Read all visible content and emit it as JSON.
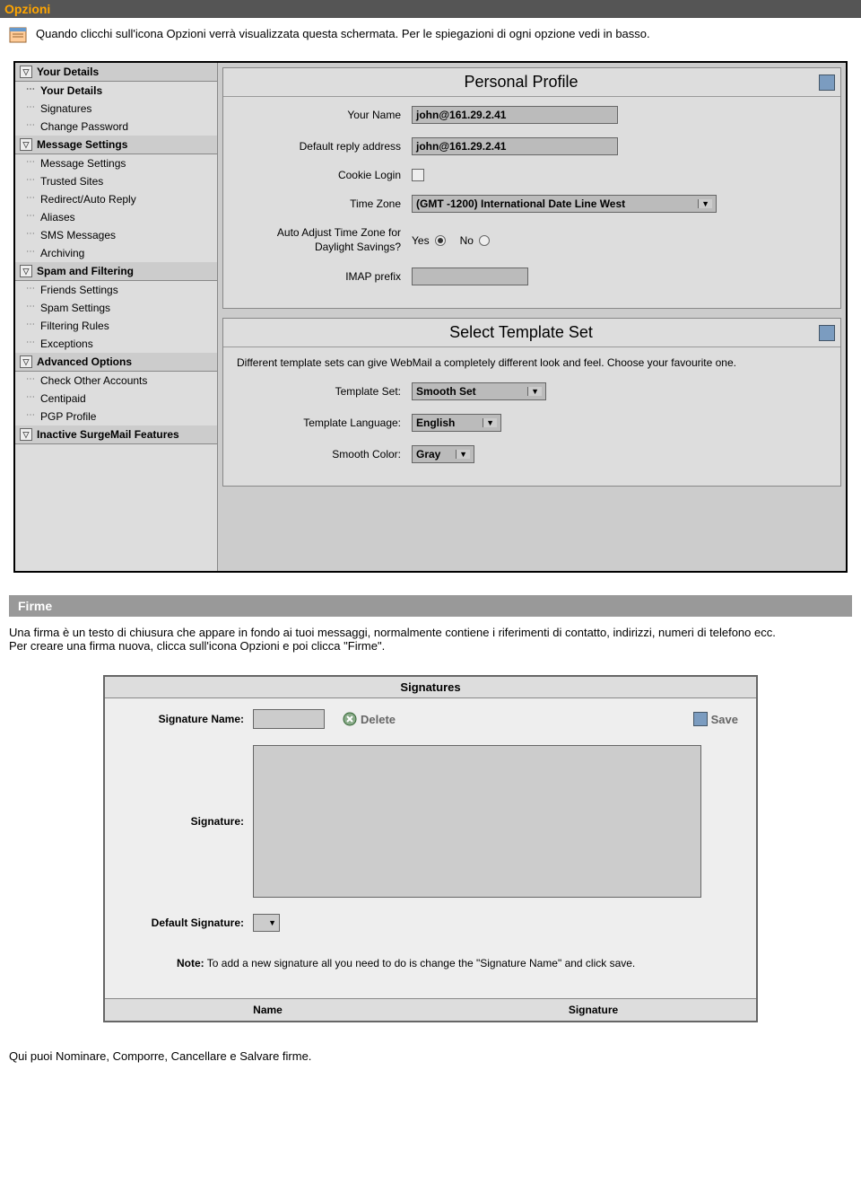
{
  "section1": {
    "title": "Opzioni",
    "intro": "Quando clicchi sull'icona Opzioni verrà visualizzata questa schermata. Per le spiegazioni di ogni opzione vedi in basso."
  },
  "sidebar": {
    "sections": [
      {
        "title": "Your Details",
        "items": [
          "Your Details",
          "Signatures",
          "Change Password"
        ]
      },
      {
        "title": "Message Settings",
        "items": [
          "Message Settings",
          "Trusted Sites",
          "Redirect/Auto Reply",
          "Aliases",
          "SMS Messages",
          "Archiving"
        ]
      },
      {
        "title": "Spam and Filtering",
        "items": [
          "Friends Settings",
          "Spam Settings",
          "Filtering Rules",
          "Exceptions"
        ]
      },
      {
        "title": "Advanced Options",
        "items": [
          "Check Other Accounts",
          "Centipaid",
          "PGP Profile"
        ]
      },
      {
        "title": "Inactive SurgeMail Features",
        "items": []
      }
    ]
  },
  "profile": {
    "title": "Personal Profile",
    "labels": {
      "name": "Your Name",
      "reply": "Default reply address",
      "cookie": "Cookie Login",
      "tz": "Time Zone",
      "dst": "Auto Adjust Time Zone for Daylight Savings?",
      "imap": "IMAP prefix"
    },
    "values": {
      "name": "john@161.29.2.41",
      "reply": "john@161.29.2.41",
      "tz": "(GMT -1200) International Date Line West"
    },
    "yes": "Yes",
    "no": "No"
  },
  "template": {
    "title": "Select Template Set",
    "desc": "Different template sets can give WebMail a completely different look and feel. Choose your favourite one.",
    "labels": {
      "set": "Template Set:",
      "lang": "Template Language:",
      "color": "Smooth Color:"
    },
    "values": {
      "set": "Smooth Set",
      "lang": "English",
      "color": "Gray"
    }
  },
  "section2": {
    "title": "Firme",
    "p1": "Una firma è un testo di chiusura che appare in fondo ai tuoi messaggi, normalmente contiene i riferimenti di contatto, indirizzi, numeri di telefono ecc.",
    "p2": "Per creare una firma nuova, clicca sull'icona Opzioni e poi clicca \"Firme\"."
  },
  "sig": {
    "title": "Signatures",
    "name_label": "Signature Name:",
    "delete": "Delete",
    "save": "Save",
    "sig_label": "Signature:",
    "default_label": "Default Signature:",
    "note_label": "Note:",
    "note": " To add a new signature all you need to do is change the \"Signature Name\" and click save.",
    "th1": "Name",
    "th2": "Signature"
  },
  "bottom": "Qui puoi Nominare, Comporre, Cancellare e Salvare firme."
}
